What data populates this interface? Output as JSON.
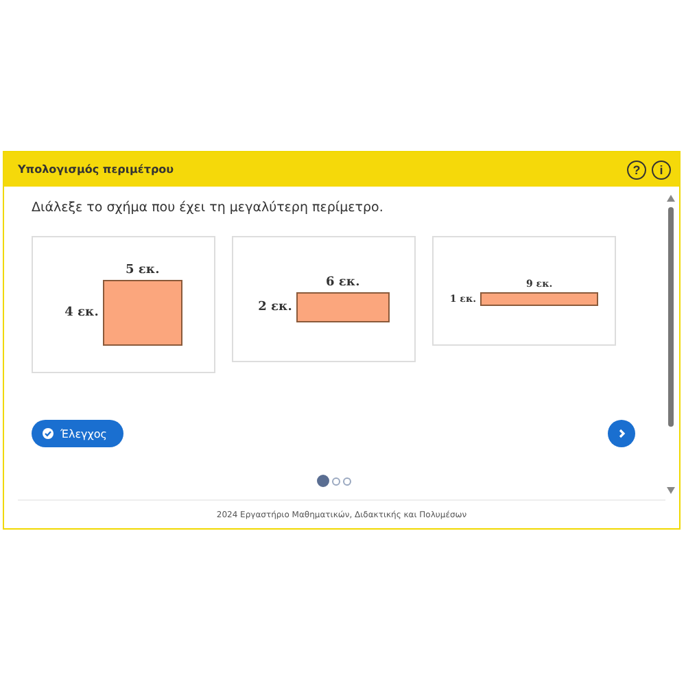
{
  "header": {
    "title": "Υπολογισμός περιμέτρου",
    "help_icon": "?",
    "info_icon": "i"
  },
  "question": "Διάλεξε το σχήμα που έχει τη μεγαλύτερη περίμετρο.",
  "options": [
    {
      "top_label": "5 εκ.",
      "side_label": "4 εκ.",
      "selected": false
    },
    {
      "top_label": "6 εκ.",
      "side_label": "2 εκ.",
      "selected": false
    },
    {
      "top_label": "9 εκ.",
      "side_label": "1 εκ.",
      "selected": false
    }
  ],
  "check_button": "Έλεγχος",
  "pages": [
    {
      "selected": true
    },
    {
      "selected": false
    },
    {
      "selected": false
    }
  ],
  "footer": "2024 Εργαστήριο Μαθηματικών, Διδακτικής και Πολυμέσων"
}
